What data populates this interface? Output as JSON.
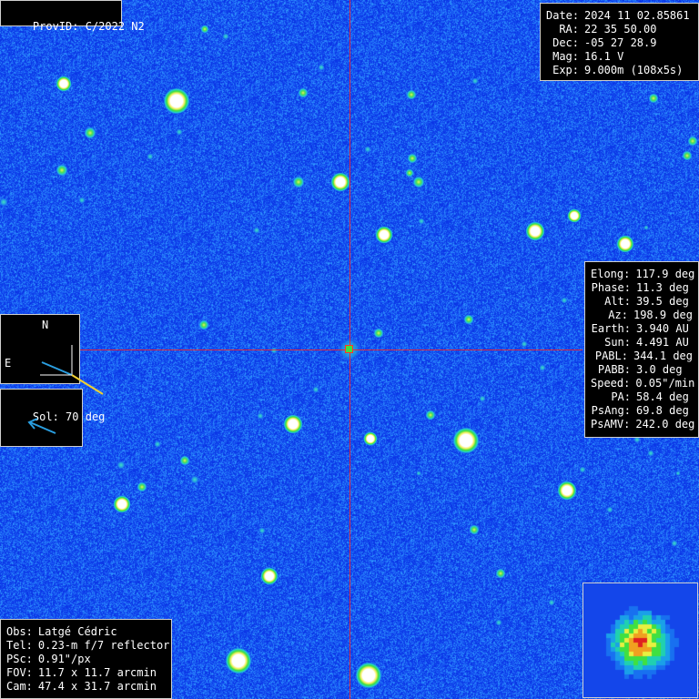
{
  "object": {
    "provid_label": "ProvID:",
    "provid_value": "C/2022 N2"
  },
  "observation": [
    {
      "label": "Date:",
      "value": "2024 11 02.85861"
    },
    {
      "label": "RA:",
      "value": "22 35 50.00"
    },
    {
      "label": "Dec:",
      "value": "-05 27 28.9"
    },
    {
      "label": "Mag:",
      "value": "16.1 V"
    },
    {
      "label": "Exp:",
      "value": "9.000m (108x5s)"
    }
  ],
  "geometry": [
    {
      "label": "Elong:",
      "value": "117.9 deg"
    },
    {
      "label": "Phase:",
      "value": "11.3 deg"
    },
    {
      "label": "Alt:",
      "value": "39.5 deg"
    },
    {
      "label": "Az:",
      "value": "198.9 deg"
    },
    {
      "label": "Earth:",
      "value": "3.940 AU"
    },
    {
      "label": "Sun:",
      "value": "4.491 AU"
    },
    {
      "label": "PABL:",
      "value": "344.1 deg"
    },
    {
      "label": "PABB:",
      "value": "3.0 deg"
    },
    {
      "label": "Speed:",
      "value": "0.05\"/min"
    },
    {
      "label": "PA:",
      "value": "58.4 deg"
    },
    {
      "label": "PsAng:",
      "value": "69.8 deg"
    },
    {
      "label": "PsAMV:",
      "value": "242.0 deg"
    }
  ],
  "compass": {
    "north": "N",
    "east": "E"
  },
  "sun_direction": {
    "label": "Sol:",
    "value": "70 deg"
  },
  "instrument": [
    {
      "label": "Obs:",
      "value": "Latgé Cédric"
    },
    {
      "label": "Tel:",
      "value": "0.23-m f/7 reflector"
    },
    {
      "label": "PSc:",
      "value": "0.91\"/px"
    },
    {
      "label": "FOV:",
      "value": "11.7 x 11.7 arcmin"
    },
    {
      "label": "Cam:",
      "value": "47.4 x 31.7 arcmin"
    }
  ],
  "colors": {
    "sky": "#1240ee",
    "crosshair": "#ff2020",
    "compass_north_east": "#2a9ee0",
    "compass_tail": "#f0d030",
    "sun_arrow": "#2a9ee0"
  }
}
